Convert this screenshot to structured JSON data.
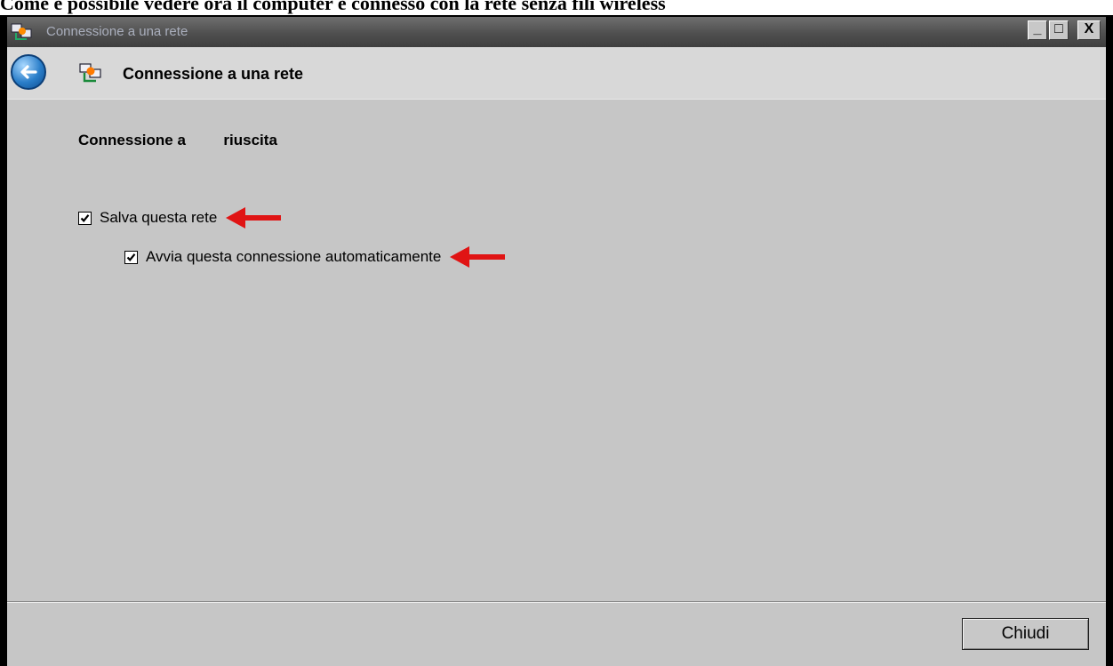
{
  "caption": "Come è possibile vedere ora il computer è connesso con la rete senza fili wireless",
  "window": {
    "title": "Connessione a una rete",
    "controls": {
      "minimize": "_",
      "maximize": "□",
      "close": "X"
    }
  },
  "navbar": {
    "title": "Connessione a una rete"
  },
  "content": {
    "heading": "Connessione a         riuscita",
    "options": [
      {
        "label": "Salva questa rete",
        "checked": true
      },
      {
        "label": "Avvia questa connessione automaticamente",
        "checked": true
      }
    ]
  },
  "footer": {
    "close_label": "Chiudi"
  },
  "colors": {
    "annotation_arrow": "#e01414",
    "content_bg": "#c6c6c6"
  }
}
